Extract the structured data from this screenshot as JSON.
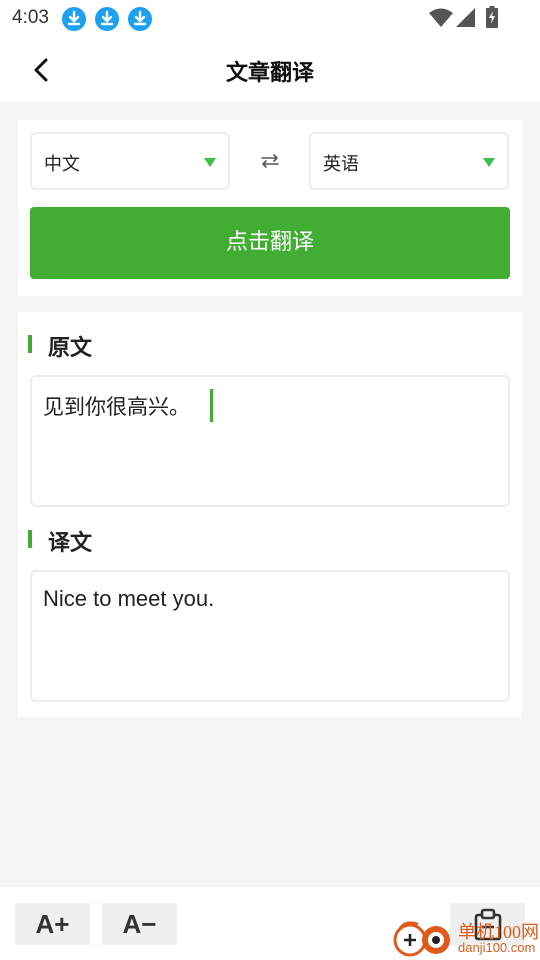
{
  "status_bar": {
    "time": "4:03",
    "notification_icons": [
      "download-icon",
      "download-icon",
      "download-icon"
    ],
    "system_icons": [
      "wifi-icon",
      "signal-icon",
      "battery-charging-icon"
    ]
  },
  "header": {
    "back_icon": "chevron-left-icon",
    "title": "文章翻译"
  },
  "languages": {
    "source": "中文",
    "target": "英语",
    "swap_icon": "swap-arrows-icon"
  },
  "translate_button": "点击翻译",
  "source_section": {
    "title": "原文",
    "text": "见到你很高兴。"
  },
  "result_section": {
    "title": "译文",
    "text": "Nice to meet you."
  },
  "bottom_bar": {
    "font_increase": "A+",
    "font_decrease": "A−",
    "copy_icon": "clipboard-icon"
  },
  "watermark": {
    "text": "单机100网",
    "domain": "danji100.com"
  },
  "colors": {
    "accent": "#41ad33",
    "caret": "#3bc04a",
    "download_badge": "#1ea0f0",
    "watermark": "#e05a1a"
  }
}
